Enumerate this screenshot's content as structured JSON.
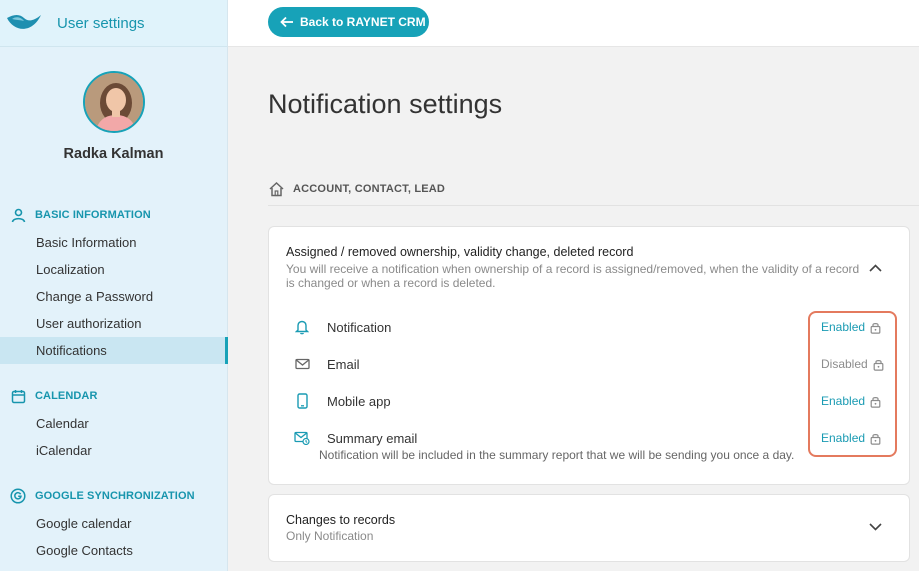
{
  "app": {
    "title": "User settings"
  },
  "profile": {
    "name": "Radka Kalman"
  },
  "sidebar": {
    "sections": [
      {
        "label": "BASIC INFORMATION",
        "icon": "user-icon",
        "items": [
          {
            "label": "Basic Information"
          },
          {
            "label": "Localization"
          },
          {
            "label": "Change a Password"
          },
          {
            "label": "User authorization"
          },
          {
            "label": "Notifications",
            "active": true
          }
        ]
      },
      {
        "label": "CALENDAR",
        "icon": "calendar-icon",
        "items": [
          {
            "label": "Calendar"
          },
          {
            "label": "iCalendar"
          }
        ]
      },
      {
        "label": "GOOGLE SYNCHRONIZATION",
        "icon": "google-icon",
        "items": [
          {
            "label": "Google calendar"
          },
          {
            "label": "Google Contacts"
          }
        ]
      }
    ]
  },
  "topbar": {
    "back_label": "Back to RAYNET CRM"
  },
  "main": {
    "title": "Notification settings",
    "breadcrumb": "ACCOUNT, CONTACT, LEAD",
    "cards": [
      {
        "title": "Assigned / removed ownership, validity change, deleted record",
        "description_line1": "You will receive a notification when ownership of a record is assigned/removed, when the validity of a record",
        "description_line2": "is changed or when a record is deleted.",
        "expanded": true,
        "channels": [
          {
            "label": "Notification",
            "icon": "bell-icon",
            "status": "Enabled"
          },
          {
            "label": "Email",
            "icon": "envelope-icon",
            "status": "Disabled"
          },
          {
            "label": "Mobile app",
            "icon": "smartphone-icon",
            "status": "Enabled"
          },
          {
            "label": "Summary email",
            "icon": "summary-email-icon",
            "status": "Enabled",
            "sublabel": "Notification will be included in the summary report that we will be sending you once a day."
          }
        ]
      },
      {
        "title": "Changes to records",
        "subtitle": "Only Notification",
        "expanded": false
      }
    ]
  },
  "colors": {
    "accent": "#17a2b8",
    "enabled": "#1a9bb3",
    "disabled": "#8c8c8c",
    "highlight": "#e47a5e",
    "sidebar_bg": "#e3f2fa"
  }
}
